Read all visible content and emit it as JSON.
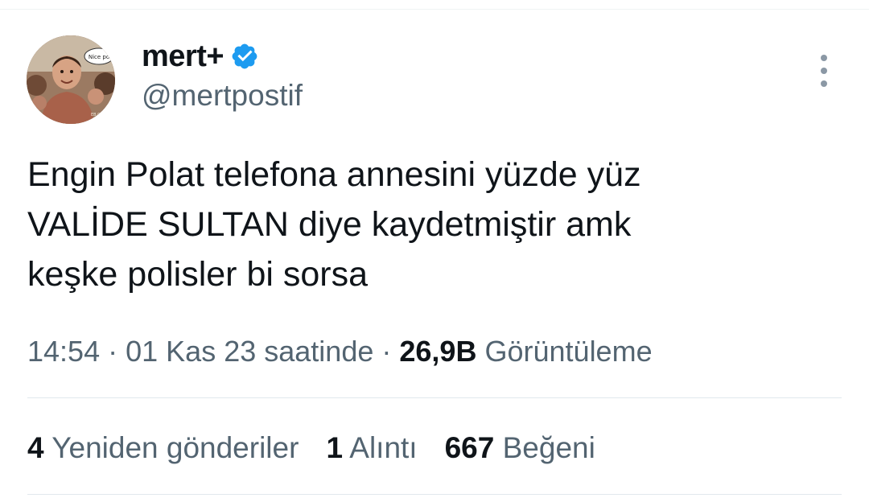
{
  "author": {
    "display_name": "mert+",
    "handle": "@mertpostif",
    "verified": true,
    "avatar_caption": "Nice po",
    "avatar_watermark": "EB OD 4"
  },
  "tweet": {
    "text_lines": [
      "Engin Polat telefona annesini yüzde yüz",
      "VALİDE SULTAN diye kaydetmiştir amk",
      "keşke polisler bi sorsa"
    ]
  },
  "meta": {
    "time": "14:54",
    "separator": "·",
    "date": "01 Kas 23 saatinde",
    "views_count": "26,9B",
    "views_label": "Görüntüleme"
  },
  "stats": {
    "retweets_count": "4",
    "retweets_label": "Yeniden gönderiler",
    "quotes_count": "1",
    "quotes_label": "Alıntı",
    "likes_count": "667",
    "likes_label": "Beğeni"
  },
  "colors": {
    "text_primary": "#0f1419",
    "text_secondary": "#536471",
    "verified_blue": "#1d9bf0",
    "divider": "#e1e8ed"
  },
  "icons": {
    "verified": "verified-badge-icon",
    "more": "more-options-icon"
  }
}
